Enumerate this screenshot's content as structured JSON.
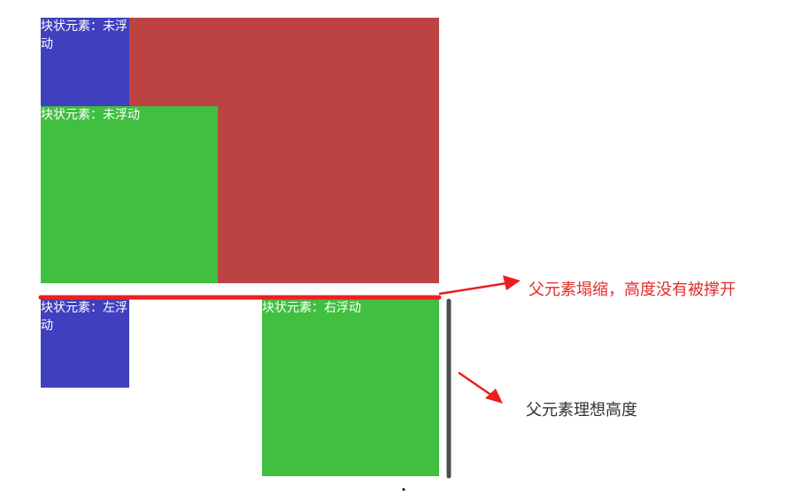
{
  "colors": {
    "parent_red": "#bd4343",
    "block_blue": "#4040bf",
    "block_green": "#40bf40",
    "collapse_line_red": "#f01f1f",
    "ideal_height_bar": "#4d4d4d",
    "arrow_red": "#ee1c1c",
    "collapse_text": "#e02c2c",
    "ideal_text": "#333333"
  },
  "blocks": {
    "blue_unfloated": "块状元素：未浮动",
    "green_unfloated": "块状元素：未浮动",
    "blue_float_left": "块状元素：左浮动",
    "green_float_right": "块状元素：右浮动"
  },
  "annotations": {
    "collapse": "父元素塌缩，高度没有被撑开",
    "ideal_height": "父元素理想高度"
  }
}
